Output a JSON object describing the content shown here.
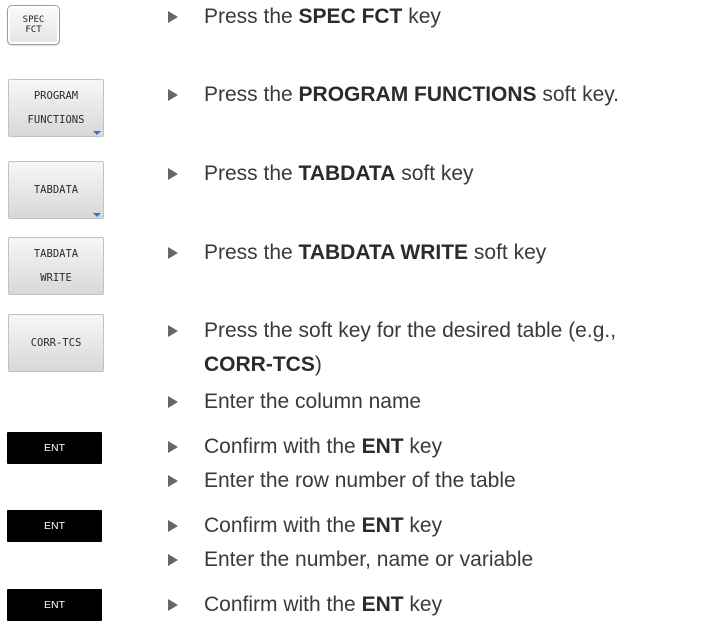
{
  "keys": {
    "spec_fct": {
      "line1": "SPEC",
      "line2": "FCT"
    },
    "program_functions": {
      "line1": "PROGRAM",
      "line2": "FUNCTIONS"
    },
    "tabdata": {
      "label": "TABDATA"
    },
    "tabdata_write": {
      "line1": "TABDATA",
      "line2": "WRITE"
    },
    "corr_tcs": {
      "label": "CORR-TCS"
    },
    "ent": {
      "label": "ENT"
    }
  },
  "steps": [
    {
      "pre": "Press the ",
      "bold": "SPEC FCT",
      "post": " key"
    },
    {
      "pre": "Press the ",
      "bold": "PROGRAM FUNCTIONS",
      "post": " soft key."
    },
    {
      "pre": "Press the ",
      "bold": "TABDATA",
      "post": " soft key"
    },
    {
      "pre": "Press the ",
      "bold": "TABDATA WRITE",
      "post": " soft key"
    },
    {
      "line1": "Press the soft key for the desired table (e.g.,",
      "bold": "CORR-TCS",
      "post": ")"
    },
    {
      "text": "Enter the column name"
    },
    {
      "pre": "Confirm with the ",
      "bold": "ENT",
      "post": " key"
    },
    {
      "text": "Enter the row number of the table"
    },
    {
      "pre": "Confirm with the ",
      "bold": "ENT",
      "post": " key"
    },
    {
      "text": "Enter the number, name or variable"
    },
    {
      "pre": "Confirm with the ",
      "bold": "ENT",
      "post": " key"
    }
  ],
  "colors": {
    "bullet": "#666666",
    "softkey_arrow": "#2f6fd6",
    "ent_key": "#000000"
  }
}
